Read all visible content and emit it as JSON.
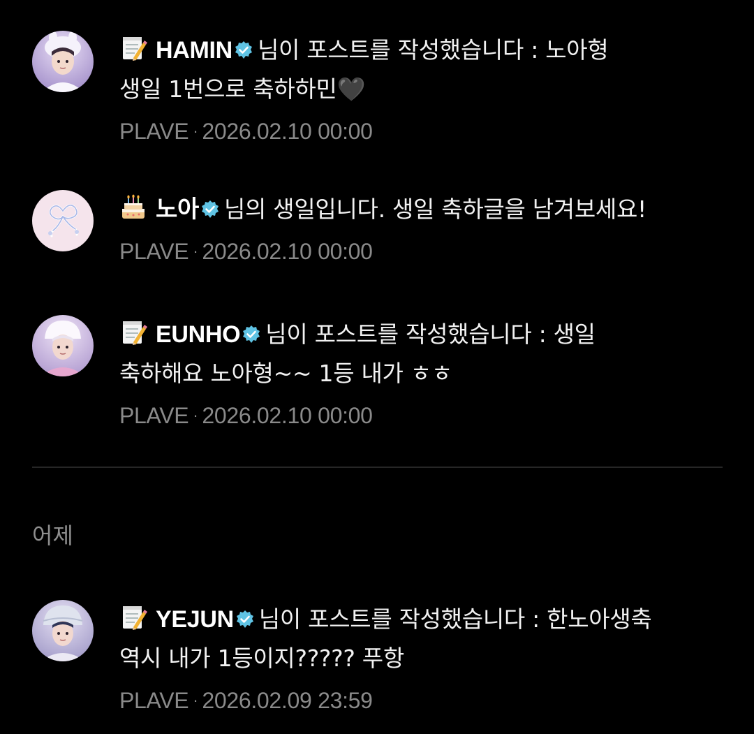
{
  "notifications": [
    {
      "icon": "memo-icon",
      "name": "HAMIN",
      "message": "님이 포스트를 작성했습니다 : 노아형",
      "message_line2": "생일 1번으로 축하하민🖤",
      "source": "PLAVE",
      "separator": "·",
      "timestamp": "2026.02.10 00:00",
      "avatar_color": "#b7a6d8"
    },
    {
      "icon": "birthday-cake-icon",
      "name": "노아",
      "message": "님의 생일입니다. 생일 축하글을 남겨보세요!",
      "source": "PLAVE",
      "separator": "·",
      "timestamp": "2026.02.10 00:00",
      "avatar_color": "#f3dde6"
    },
    {
      "icon": "memo-icon",
      "name": "EUNHO",
      "message": "님이 포스트를 작성했습니다 : 생일",
      "message_line2": "축하해요 노아형~~ 1등 내가 ㅎㅎ",
      "source": "PLAVE",
      "separator": "·",
      "timestamp": "2026.02.10 00:00",
      "avatar_color": "#c9b6de"
    }
  ],
  "section_yesterday": {
    "label": "어제"
  },
  "yesterday_notifications": [
    {
      "icon": "memo-icon",
      "name": "YEJUN",
      "message": "님이 포스트를 작성했습니다 : 한노아생축",
      "message_line2": "역시 내가 1등이지????? 푸항",
      "source": "PLAVE",
      "separator": "·",
      "timestamp": "2026.02.09 23:59",
      "avatar_color": "#b9b3d6"
    }
  ],
  "colors": {
    "background": "#000000",
    "verified_badge": "#5fc3e4",
    "meta_text": "#8a8a8a"
  }
}
